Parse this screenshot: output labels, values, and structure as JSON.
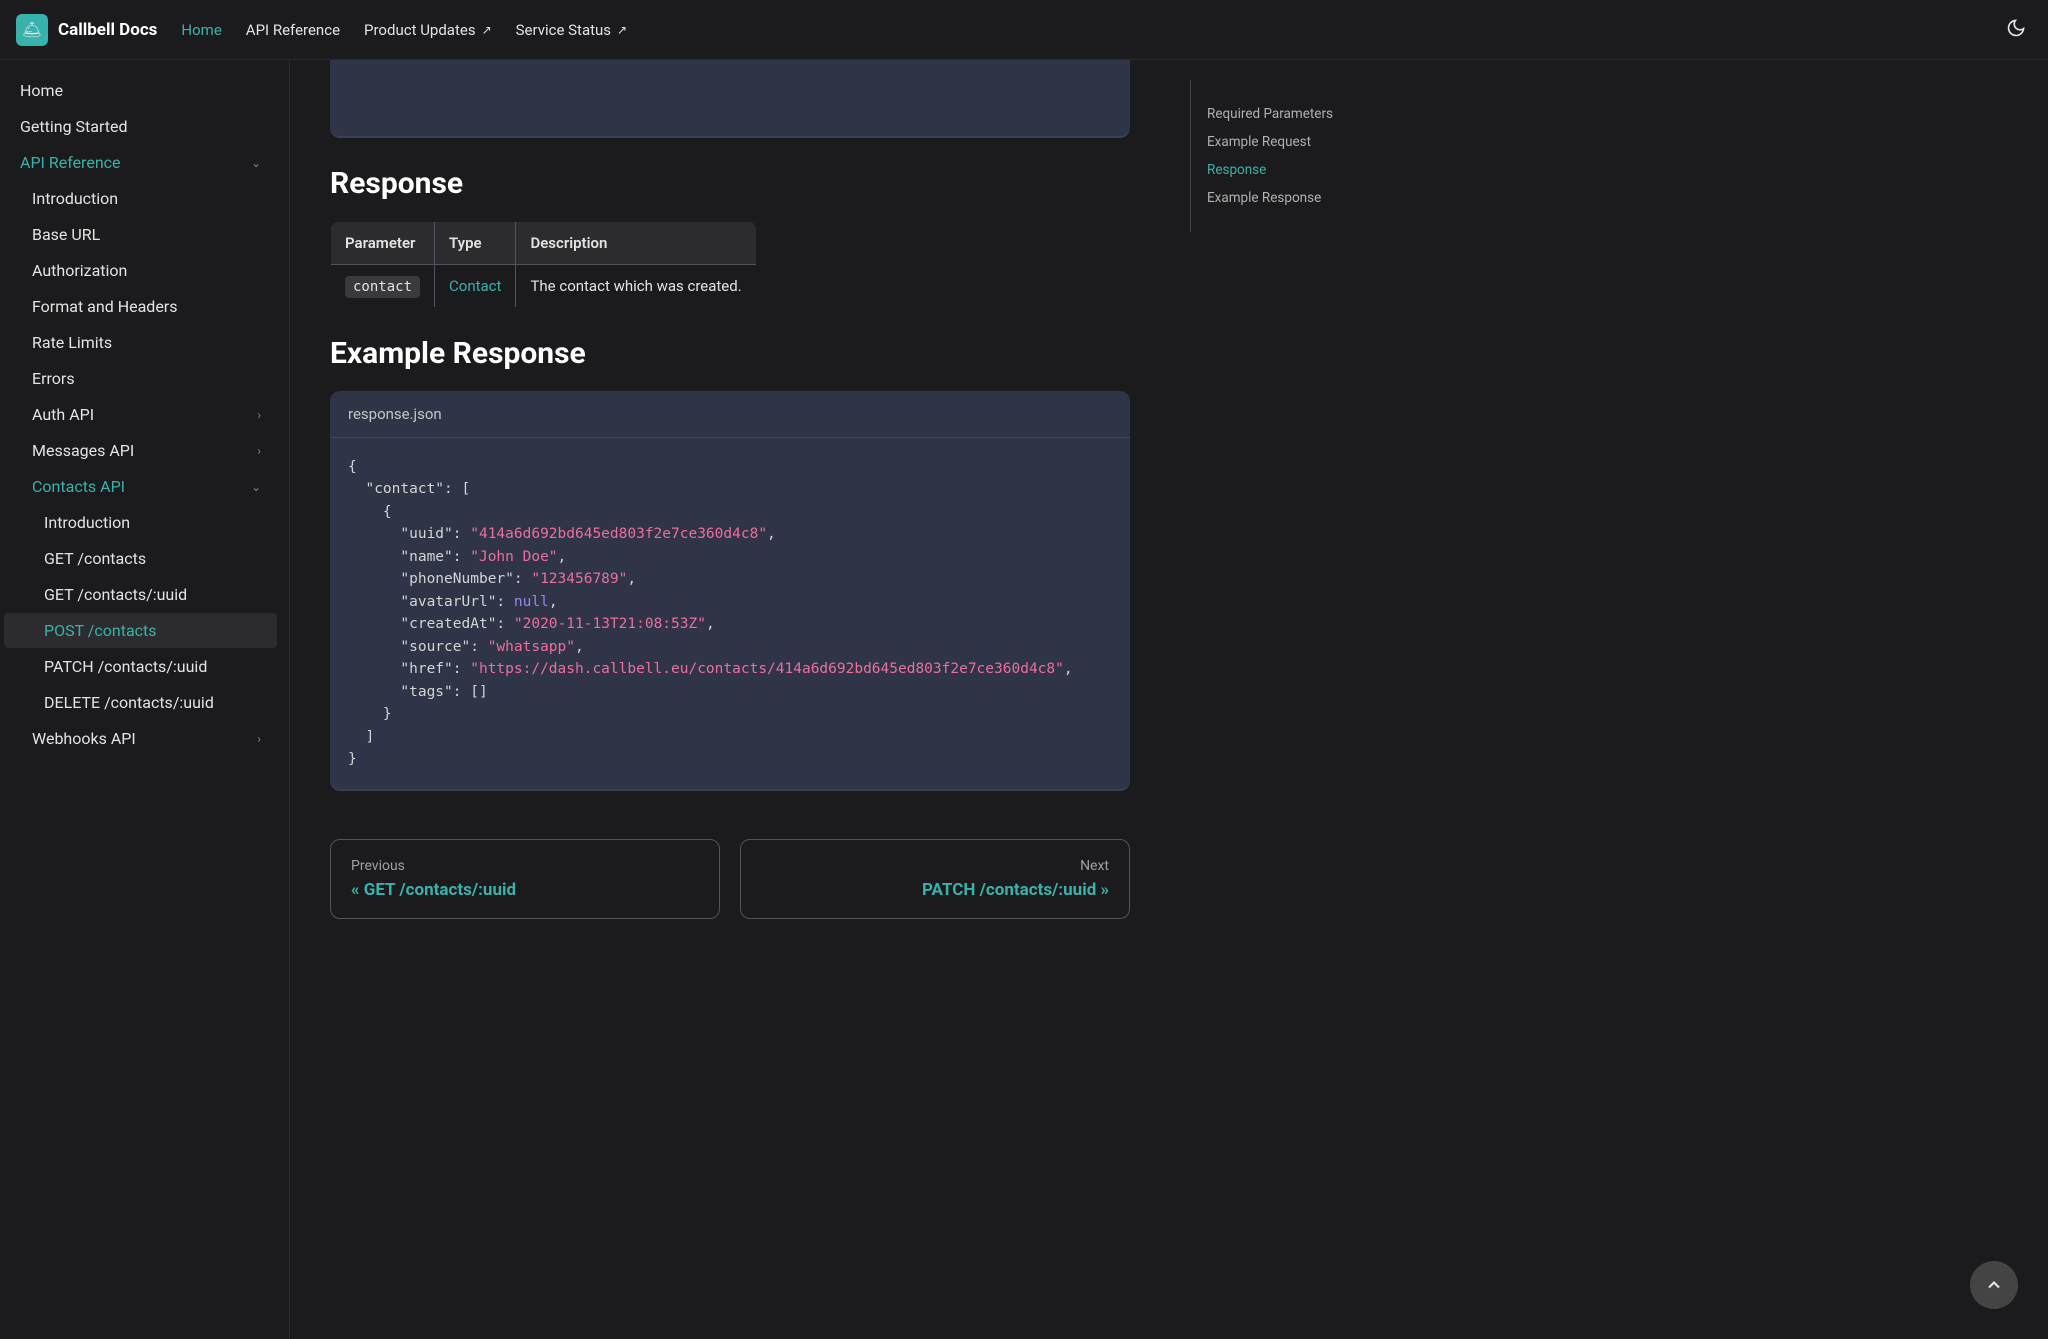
{
  "header": {
    "logo": "Callbell Docs",
    "nav": {
      "home": "Home",
      "api": "API Reference",
      "updates": "Product Updates",
      "status": "Service Status"
    }
  },
  "sidebar": {
    "home": "Home",
    "getting_started": "Getting Started",
    "api_reference": "API Reference",
    "introduction": "Introduction",
    "base_url": "Base URL",
    "authorization": "Authorization",
    "format": "Format and Headers",
    "rate_limits": "Rate Limits",
    "errors": "Errors",
    "auth_api": "Auth API",
    "messages_api": "Messages API",
    "contacts_api": "Contacts API",
    "contacts_intro": "Introduction",
    "get_contacts": "GET /contacts",
    "get_contact": "GET /contacts/:uuid",
    "post_contacts": "POST /contacts",
    "patch_contact": "PATCH /contacts/:uuid",
    "delete_contact": "DELETE /contacts/:uuid",
    "webhooks_api": "Webhooks API"
  },
  "main": {
    "response_h": "Response",
    "table": {
      "h1": "Parameter",
      "h2": "Type",
      "h3": "Description",
      "r1c1": "contact",
      "r1c2": "Contact",
      "r1c3": "The contact which was created."
    },
    "example_h": "Example Response",
    "code_title": "response.json",
    "json": {
      "uuid": "\"414a6d692bd645ed803f2e7ce360d4c8\"",
      "name": "\"John Doe\"",
      "phone": "\"123456789\"",
      "avatar": "null",
      "created": "\"2020-11-13T21:08:53Z\"",
      "source": "\"whatsapp\"",
      "href": "\"https://dash.callbell.eu/contacts/414a6d692bd645ed803f2e7ce360d4c8\""
    },
    "prev_label": "Previous",
    "prev_title": "« GET /contacts/:uuid",
    "next_label": "Next",
    "next_title": "PATCH /contacts/:uuid »"
  },
  "toc": {
    "required": "Required Parameters",
    "request": "Example Request",
    "response": "Response",
    "example_response": "Example Response"
  }
}
